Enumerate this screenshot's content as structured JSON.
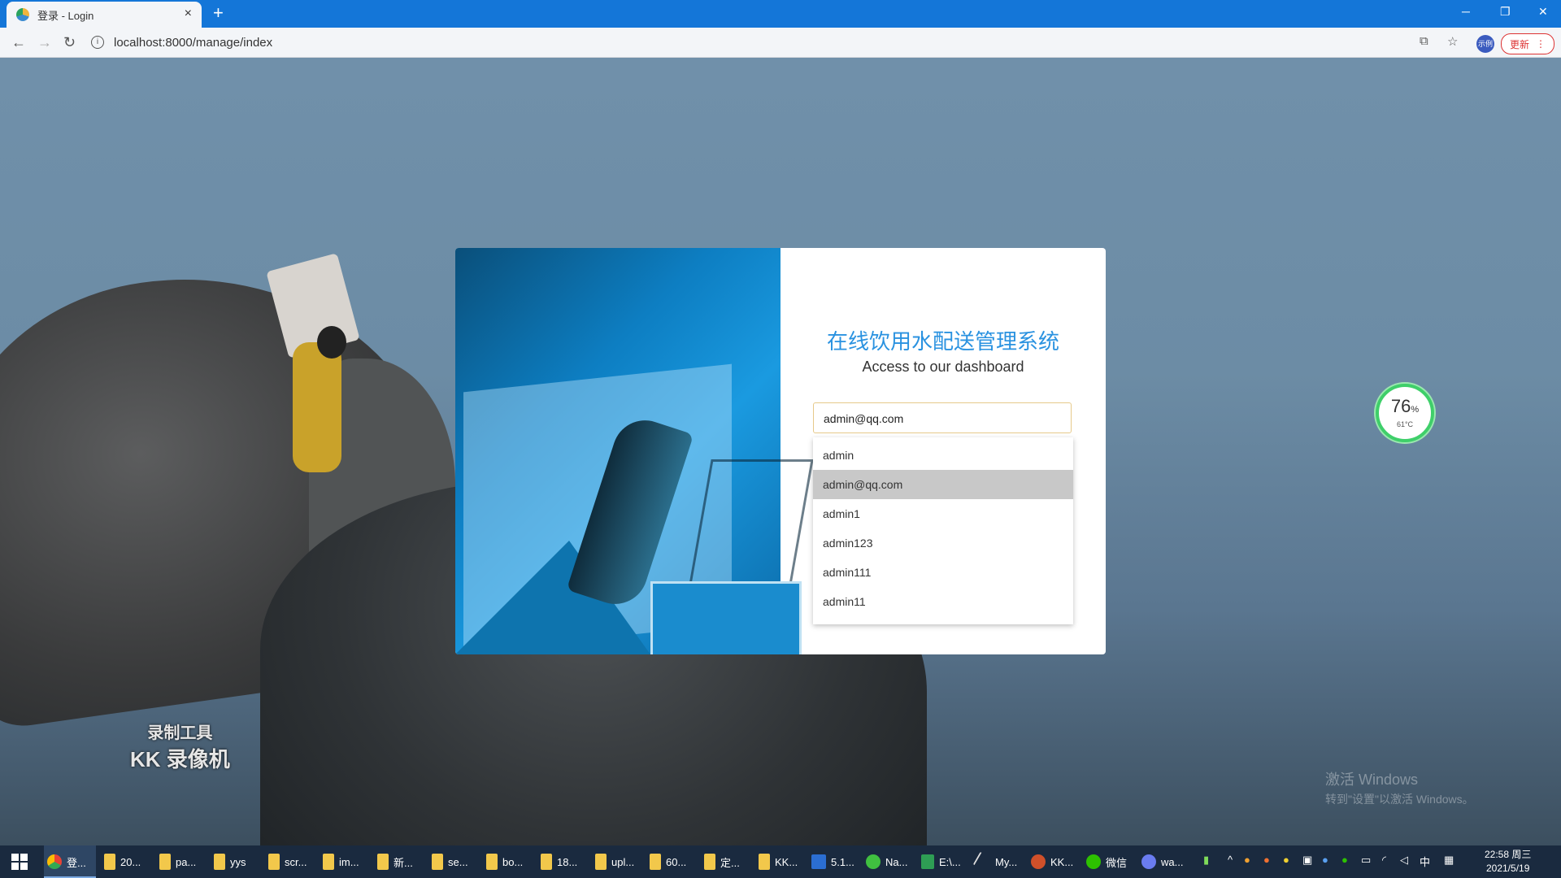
{
  "browser": {
    "tab_title": "登录 - Login",
    "close_glyph": "×",
    "newtab_glyph": "+",
    "url": "localhost:8000/manage/index",
    "avatar_text": "示例",
    "update_label": "更新",
    "minimize_glyph": "─",
    "restore_glyph": "❐",
    "close_window_glyph": "✕",
    "back_glyph": "←",
    "forward_glyph": "→",
    "reload_glyph": "↻",
    "info_glyph": "i",
    "translate_glyph": "⧉",
    "star_glyph": "☆",
    "menu_glyph": "⋮"
  },
  "login": {
    "title": "在线饮用水配送管理系统",
    "subtitle": "Access to our dashboard",
    "email_value": "admin@qq.com",
    "autocomplete": [
      "admin",
      "admin@qq.com",
      "admin1",
      "admin123",
      "admin111",
      "admin11"
    ],
    "selected_index": 1
  },
  "desktop": {
    "kk_line1": "录制工具",
    "kk_line2": "KK 录像机",
    "activate_line1": "激活 Windows",
    "activate_line2": "转到\"设置\"以激活 Windows。",
    "gauge_value": "76",
    "gauge_unit": "%",
    "gauge_temp": "61°C"
  },
  "taskbar": {
    "items": [
      "登...",
      "20...",
      "pa...",
      "yys",
      "scr...",
      "im...",
      "新...",
      "se...",
      "bo...",
      "18...",
      "upl...",
      "60...",
      "定...",
      "KK...",
      "5.1...",
      "Na...",
      "E:\\...",
      "My...",
      "KK...",
      "微信",
      "wa..."
    ],
    "ime": "中",
    "time": "22:58 周三",
    "date": "2021/5/19"
  }
}
